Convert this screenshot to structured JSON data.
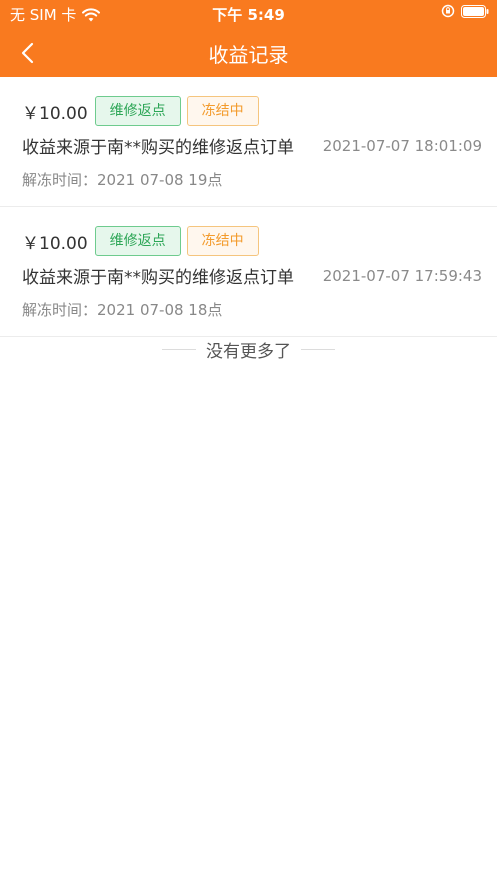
{
  "status_bar": {
    "carrier": "无 SIM 卡",
    "time": "下午 5:49"
  },
  "nav": {
    "title": "收益记录",
    "back_icon": "chevron-left-icon"
  },
  "records": [
    {
      "amount": "￥10.00",
      "type_tag": "维修返点",
      "status_tag": "冻结中",
      "description": "收益来源于南**购买的维修返点订单",
      "time": "2021-07-07 18:01:09",
      "unfreeze_label": "解冻时间：",
      "unfreeze_time": "2021 07-08 19点"
    },
    {
      "amount": "￥10.00",
      "type_tag": "维修返点",
      "status_tag": "冻结中",
      "description": "收益来源于南**购买的维修返点订单",
      "time": "2021-07-07 17:59:43",
      "unfreeze_label": "解冻时间：",
      "unfreeze_time": "2021 07-08 18点"
    }
  ],
  "footer": {
    "no_more": "没有更多了"
  },
  "colors": {
    "header_bg": "#F97A1F",
    "tag_green": "#2DA657",
    "tag_orange": "#F39B2C"
  }
}
